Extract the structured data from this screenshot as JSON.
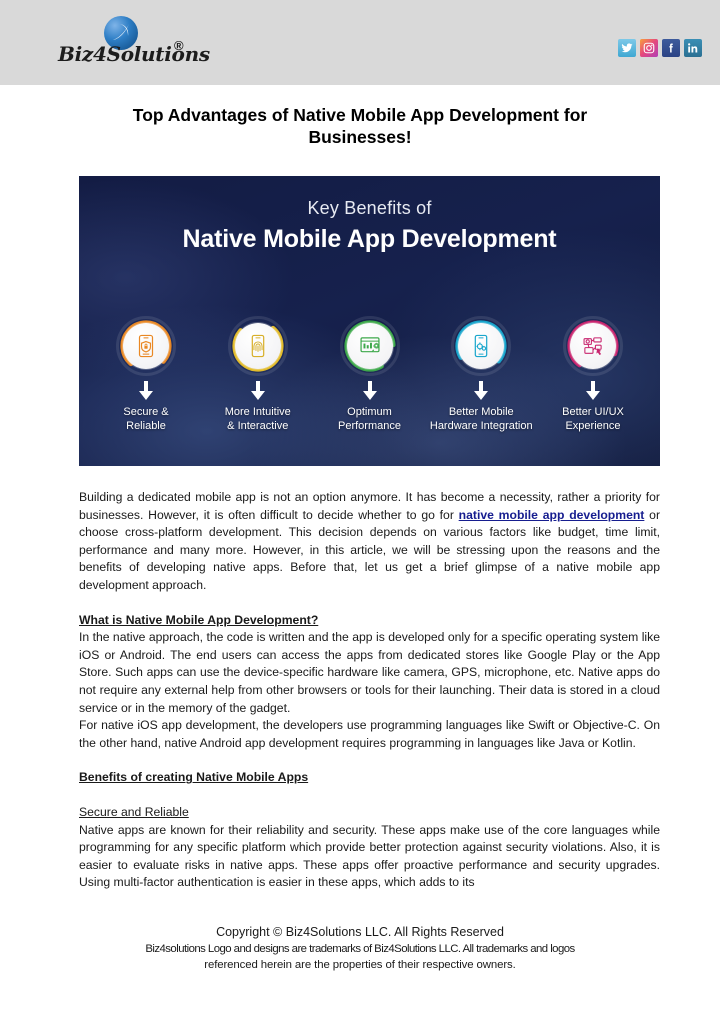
{
  "header": {
    "logo_text": "Biz4Solutions",
    "logo_registered": "®",
    "social": [
      {
        "name": "twitter",
        "label": "t"
      },
      {
        "name": "instagram",
        "label": ""
      },
      {
        "name": "facebook",
        "label": "f"
      },
      {
        "name": "linkedin",
        "label": "in"
      }
    ]
  },
  "page_title": "Top Advantages of Native Mobile App Development for Businesses!",
  "infographic": {
    "subtitle": "Key Benefits of",
    "title": "Native Mobile App Development",
    "nodes": [
      {
        "label": "Secure &\nReliable",
        "color": "#e98824",
        "icon": "phone-lock-shield-icon"
      },
      {
        "label": "More Intuitive\n& Interactive",
        "color": "#e2bb2a",
        "icon": "phone-fingerprint-icon"
      },
      {
        "label": "Optimum\nPerformance",
        "color": "#3da84a",
        "icon": "dashboard-rocket-icon"
      },
      {
        "label": "Better Mobile\nHardware Integration",
        "color": "#17a5cc",
        "icon": "phone-gears-icon"
      },
      {
        "label": "Better UI/UX\nExperience",
        "color": "#c8246e",
        "icon": "wireframe-sketch-icon"
      }
    ]
  },
  "body": {
    "intro_part1": "Building a dedicated mobile app is not an option anymore. It has become a necessity, rather a priority for businesses. However, it is often difficult to decide whether to go for ",
    "intro_link": "native mobile app development",
    "intro_part2": " or choose cross-platform development. This decision depends on various factors like budget, time limit, performance and many more. However, in this article, we will be stressing upon the reasons and the benefits of developing native apps. Before that, let us get a brief glimpse of a native mobile app development approach.",
    "heading_what_is": "What is Native Mobile App Development?",
    "para_what_is": "In the native approach, the code is written and the app is developed only for a specific operating system like iOS or Android. The end users can access the apps from dedicated stores like Google Play or the App Store. Such apps can use the device-specific hardware like camera, GPS, microphone, etc. Native apps do not require any external help from other browsers or tools for their launching. Their data is stored in a cloud service or in the memory of the gadget.",
    "para_languages": "For native iOS app development, the developers use programming languages like Swift or Objective-C. On the other hand, native Android app development requires programming in languages like Java or Kotlin.",
    "heading_benefits": "Benefits of creating Native Mobile Apps",
    "heading_secure": "Secure and Reliable",
    "para_secure": "Native apps are known for their reliability and security. These apps make use of the core languages while programming for any specific platform which provide better protection against security violations. Also, it is easier to evaluate risks in native apps. These apps offer proactive performance and security upgrades.  Using multi-factor authentication is easier in these apps, which adds to its"
  },
  "footer": {
    "line1": "Copyright © Biz4Solutions LLC. All Rights Reserved",
    "line2": "Biz4solutions Logo and designs are trademarks of Biz4Solutions LLC. All trademarks and logos",
    "line3": "referenced herein are the properties of their respective owners."
  },
  "colors": {
    "header_band": "#d9d9d9",
    "link": "#161d8f",
    "infographic_bg": "#16204a"
  }
}
